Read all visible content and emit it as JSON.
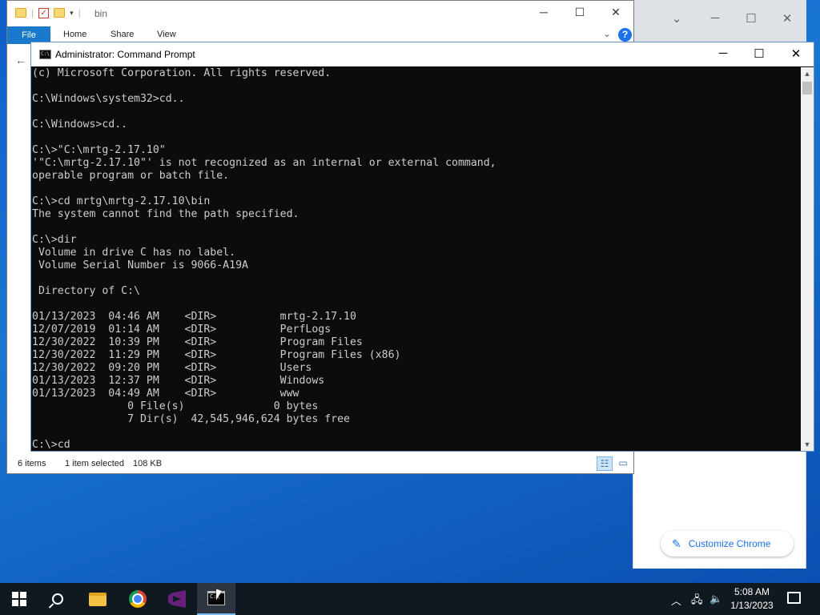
{
  "chrome": {
    "customize_label": "Customize Chrome"
  },
  "explorer": {
    "title": "bin",
    "ribbon_tabs": [
      "File",
      "Home",
      "Share",
      "View"
    ],
    "status": {
      "items": "6 items",
      "selected": "1 item selected",
      "size": "108 KB"
    }
  },
  "cmd": {
    "title": "Administrator: Command Prompt",
    "lines": [
      "(c) Microsoft Corporation. All rights reserved.",
      "",
      "C:\\Windows\\system32>cd..",
      "",
      "C:\\Windows>cd..",
      "",
      "C:\\>\"C:\\mrtg-2.17.10\"",
      "'\"C:\\mrtg-2.17.10\"' is not recognized as an internal or external command,",
      "operable program or batch file.",
      "",
      "C:\\>cd mrtg\\mrtg-2.17.10\\bin",
      "The system cannot find the path specified.",
      "",
      "C:\\>dir",
      " Volume in drive C has no label.",
      " Volume Serial Number is 9066-A19A",
      "",
      " Directory of C:\\",
      "",
      "01/13/2023  04:46 AM    <DIR>          mrtg-2.17.10",
      "12/07/2019  01:14 AM    <DIR>          PerfLogs",
      "12/30/2022  10:39 PM    <DIR>          Program Files",
      "12/30/2022  11:29 PM    <DIR>          Program Files (x86)",
      "12/30/2022  09:20 PM    <DIR>          Users",
      "01/13/2023  12:37 PM    <DIR>          Windows",
      "01/13/2023  04:49 AM    <DIR>          www",
      "               0 File(s)              0 bytes",
      "               7 Dir(s)  42,545,946,624 bytes free",
      "",
      "C:\\>cd"
    ]
  },
  "taskbar": {
    "clock_time": "5:08 AM",
    "clock_date": "1/13/2023"
  },
  "colors": {
    "console_bg": "#0c0c0c",
    "console_fg": "#cccccc",
    "explorer_file_tab": "#1979ca",
    "taskbar_bg": "#101820",
    "chrome_accent": "#1a73e8"
  }
}
